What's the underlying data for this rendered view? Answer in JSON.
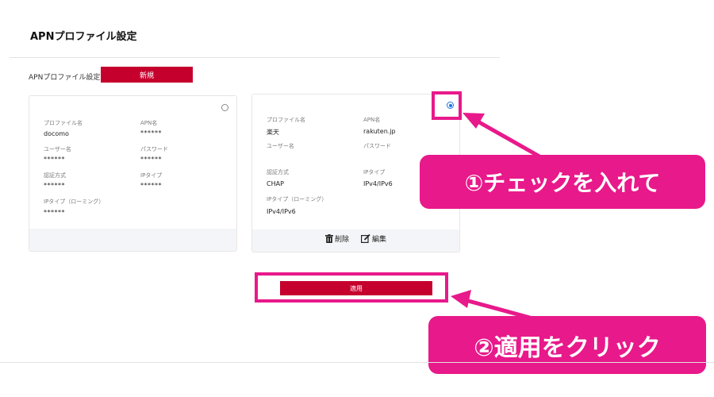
{
  "header": {
    "title": "APNプロファイル設定"
  },
  "section": {
    "label": "APNプロファイル設定",
    "new_button": "新規"
  },
  "labels": {
    "profile_name": "プロファイル名",
    "apn_name": "APN名",
    "user_name": "ユーザー名",
    "password": "パスワード",
    "auth_method": "認証方式",
    "ip_type": "IPタイプ",
    "ip_type_roaming": "IPタイプ（ローミング）"
  },
  "profiles": [
    {
      "profile_name": "docomo",
      "apn_name": "******",
      "user_name": "******",
      "password": "******",
      "auth_method": "******",
      "ip_type": "******",
      "ip_type_roaming": "******",
      "selected": false
    },
    {
      "profile_name": "楽天",
      "apn_name": "rakuten.jp",
      "user_name": "",
      "password": "",
      "auth_method": "CHAP",
      "ip_type": "IPv4/IPv6",
      "ip_type_roaming": "IPv4/IPv6",
      "selected": true,
      "actions": {
        "delete": "削除",
        "edit": "編集"
      }
    }
  ],
  "apply_button": "適用",
  "annotations": {
    "step1": "①チェックを入れて",
    "step2": "②適用をクリック",
    "highlight_color": "#e8198a"
  },
  "colors": {
    "brand": "#c5002d",
    "radio_selected": "#1a73e8"
  }
}
